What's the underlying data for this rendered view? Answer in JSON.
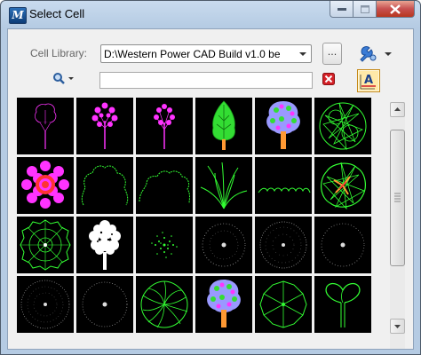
{
  "window": {
    "title": "Select Cell"
  },
  "library": {
    "label": "Cell Library:",
    "value": "D:\\Western Power CAD Build v1.0 be",
    "browse_label": "..."
  },
  "filter": {
    "value": ""
  },
  "colors": {
    "cell_bg": "#000000",
    "green": "#33ff33",
    "magenta": "#ff33ff",
    "white": "#ffffff",
    "tan": "#ff9933",
    "purple": "#9999ff"
  },
  "cells": [
    {
      "icon": "tree-outline-magenta"
    },
    {
      "icon": "tree-magenta-filled"
    },
    {
      "icon": "tree-magenta-small"
    },
    {
      "icon": "conifer-green"
    },
    {
      "icon": "tree-colored-canopy"
    },
    {
      "icon": "shrub-green-scribble"
    },
    {
      "icon": "flower-magenta-pink"
    },
    {
      "icon": "bush-outline-green"
    },
    {
      "icon": "hedge-outline-green"
    },
    {
      "icon": "grass-tuft-green"
    },
    {
      "icon": "ground-cover-line"
    },
    {
      "icon": "shrub-green-orange"
    },
    {
      "icon": "tree-plan-rings"
    },
    {
      "icon": "tree-white"
    },
    {
      "icon": "dot-cluster"
    },
    {
      "icon": "dotted-circle"
    },
    {
      "icon": "speckled-circle"
    },
    {
      "icon": "dotted-circle-small"
    },
    {
      "icon": "speckled-large-circle"
    },
    {
      "icon": "dotted-ring"
    },
    {
      "icon": "radial-branch-plan"
    },
    {
      "icon": "tree-colored-canopy-2"
    },
    {
      "icon": "wagon-wheel-plan"
    },
    {
      "icon": "palm-sprout-green"
    }
  ]
}
